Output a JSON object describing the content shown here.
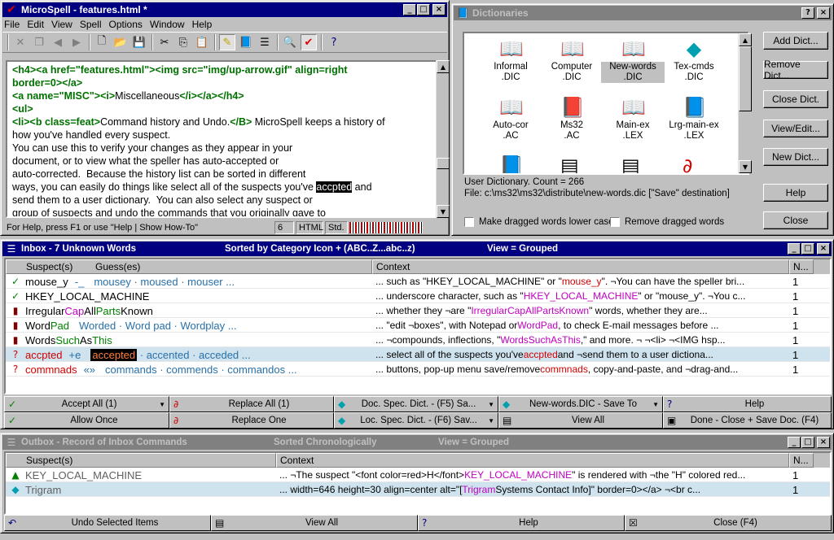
{
  "microspell": {
    "title": "MicroSpell - features.html *",
    "menu": [
      "File",
      "Edit",
      "View",
      "Spell",
      "Options",
      "Window",
      "Help"
    ],
    "editor_lines": [
      {
        "parts": [
          {
            "t": "<h4><a href=\"features.html\"><img src=\"img/up-arrow.gif\" align=right",
            "c": "tag"
          }
        ]
      },
      {
        "parts": [
          {
            "t": "border=0></a>",
            "c": "tag"
          }
        ]
      },
      {
        "parts": [
          {
            "t": "<a name=\"MISC\"><i>",
            "c": "tag"
          },
          {
            "t": "Miscellaneous",
            "c": ""
          },
          {
            "t": "</i></a></h4>",
            "c": "tag"
          }
        ]
      },
      {
        "parts": [
          {
            "t": "<ul>",
            "c": "tag"
          }
        ]
      },
      {
        "parts": [
          {
            "t": "<li><b class=feat>",
            "c": "tag"
          },
          {
            "t": "Command history and Undo.",
            "c": ""
          },
          {
            "t": "</B>",
            "c": "tag"
          },
          {
            "t": " MicroSpell keeps a history of",
            "c": ""
          }
        ]
      },
      {
        "parts": [
          {
            "t": "how you've handled every suspect.",
            "c": ""
          }
        ]
      },
      {
        "parts": [
          {
            "t": "You can use this to verify your changes as they appear in your",
            "c": ""
          }
        ]
      },
      {
        "parts": [
          {
            "t": "document, or to view what the speller has auto-accepted or",
            "c": ""
          }
        ]
      },
      {
        "parts": [
          {
            "t": "auto-corrected.  Because the history list can be sorted in different",
            "c": ""
          }
        ]
      },
      {
        "parts": [
          {
            "t": "ways, you can easily do things like select all of the suspects you've ",
            "c": ""
          },
          {
            "t": "accpted",
            "c": "hl"
          },
          {
            "t": " and",
            "c": ""
          }
        ]
      },
      {
        "parts": [
          {
            "t": "send them to a user dictionary.  You can also select any suspect or",
            "c": ""
          }
        ]
      },
      {
        "parts": [
          {
            "t": "group of suspects and undo the commands that you originally gave to",
            "c": ""
          }
        ]
      }
    ],
    "status": {
      "help": "For Help, press F1 or use \"Help | Show How-To\"",
      "line": "6",
      "mode": "HTML",
      "std": "Std."
    }
  },
  "dictionaries": {
    "title": "Dictionaries",
    "items": [
      {
        "name": "Informal",
        "ext": ".DIC",
        "icon": "book-open-icon"
      },
      {
        "name": "Computer",
        "ext": ".DIC",
        "icon": "book-open-icon"
      },
      {
        "name": "New-words",
        "ext": ".DIC",
        "icon": "book-pen-icon"
      },
      {
        "name": "Tex-cmds",
        "ext": ".DIC",
        "icon": "book-cyan-icon"
      },
      {
        "name": "Auto-cor",
        "ext": ".AC",
        "icon": "book-pen-icon"
      },
      {
        "name": "Ms32",
        "ext": ".AC",
        "icon": "book-red-icon"
      },
      {
        "name": "Main-ex",
        "ext": ".LEX",
        "icon": "book-open-icon"
      },
      {
        "name": "Lrg-main-ex",
        "ext": ".LEX",
        "icon": "book-blue-icon"
      }
    ],
    "selected_index": 2,
    "info_line1": "User Dictionary.   Count = 266",
    "info_line2": "File: c:\\ms32\\ms32\\distribute\\new-words.dic  [\"Save\" destination]",
    "checkbox_lower": "Make dragged words lower case",
    "checkbox_remove": "Remove dragged words",
    "buttons": [
      "Add Dict...",
      "Remove Dict...",
      "Close Dict.",
      "View/Edit...",
      "New Dict...",
      "Help",
      "Close"
    ]
  },
  "inbox": {
    "title": "Inbox  -  7 Unknown Words",
    "sorted": "Sorted by Category Icon + (ABC..Z...abc..z)",
    "view": "View = Grouped",
    "headers": {
      "suspect": "Suspect(s)",
      "guess": "Guess(es)",
      "context": "Context",
      "n": "N..."
    },
    "rows": [
      {
        "icon": "check-red-icon",
        "suspect": "mouse_y",
        "sparts": [
          {
            "t": "mouse_y",
            "c": ""
          }
        ],
        "extra": "-_",
        "guesses": "mousey · moused · mouser ...",
        "context": [
          {
            "t": "... such as \"HKEY_LOCAL_MACHINE\" or \"",
            "c": ""
          },
          {
            "t": "mouse_y",
            "c": "ctxred"
          },
          {
            "t": "\". ¬You can have the speller bri...",
            "c": ""
          }
        ],
        "n": "1"
      },
      {
        "icon": "check-red-icon",
        "suspect": "HKEY_LOCAL_MACHINE",
        "sparts": [
          {
            "t": "HKEY_LOCAL_MACHINE",
            "c": ""
          }
        ],
        "extra": "",
        "guesses": "",
        "context": [
          {
            "t": "... underscore character, such as \"",
            "c": ""
          },
          {
            "t": "HKEY_LOCAL_MACHINE",
            "c": "ctxmag"
          },
          {
            "t": "\" or \"mouse_y\". ¬You c...",
            "c": ""
          }
        ],
        "n": "1"
      },
      {
        "icon": "bars-icon",
        "suspect": "IrregularCapAllPartsKnown",
        "sparts": [
          {
            "t": "Irregular",
            "c": ""
          },
          {
            "t": "Cap",
            "c": "magenta"
          },
          {
            "t": "All",
            "c": ""
          },
          {
            "t": "Parts",
            "c": "green"
          },
          {
            "t": "Known",
            "c": ""
          }
        ],
        "extra": "",
        "guesses": "",
        "context": [
          {
            "t": "... whether they ¬are \"",
            "c": ""
          },
          {
            "t": "IrregularCapAllPartsKnown",
            "c": "ctxmag"
          },
          {
            "t": "\" words, whether they are...",
            "c": ""
          }
        ],
        "n": "1"
      },
      {
        "icon": "bars-icon",
        "suspect": "WordPad",
        "sparts": [
          {
            "t": "Word",
            "c": ""
          },
          {
            "t": "Pad",
            "c": "green"
          }
        ],
        "extra": "",
        "guesses": "Worded · Word pad · Wordplay ...",
        "context": [
          {
            "t": "... \"edit ¬boxes\", with Notepad or ",
            "c": ""
          },
          {
            "t": "WordPad",
            "c": "ctxmag"
          },
          {
            "t": ", to check E-mail messages before ...",
            "c": ""
          }
        ],
        "n": "1"
      },
      {
        "icon": "bars-icon",
        "suspect": "WordsSuchAsThis",
        "sparts": [
          {
            "t": "Words",
            "c": ""
          },
          {
            "t": "Such",
            "c": "green"
          },
          {
            "t": "As",
            "c": ""
          },
          {
            "t": "This",
            "c": "green"
          }
        ],
        "extra": "",
        "guesses": "",
        "context": [
          {
            "t": "... ¬compounds, inflections, \"",
            "c": ""
          },
          {
            "t": "WordsSuchAsThis",
            "c": "ctxmag"
          },
          {
            "t": ",\" and more. ¬ ¬<li> ¬<IMG hsp...",
            "c": ""
          }
        ],
        "n": "1"
      },
      {
        "icon": "question-icon",
        "suspect": "accpted",
        "sparts": [
          {
            "t": "accpted",
            "c": "red"
          }
        ],
        "extra": "+e",
        "guesses_hl": "accepted",
        "guesses": " · accented · acceded ...",
        "context": [
          {
            "t": "... select all of the suspects you've ",
            "c": ""
          },
          {
            "t": "accpted",
            "c": "ctxred"
          },
          {
            "t": " and ¬send them to a user dictiona...",
            "c": ""
          }
        ],
        "n": "1",
        "selected": true
      },
      {
        "icon": "question-icon",
        "suspect": "commnads",
        "sparts": [
          {
            "t": "commnads",
            "c": "red"
          }
        ],
        "extra": "«»",
        "guesses": "commands · commends · commandos ...",
        "context": [
          {
            "t": "... buttons, pop-up menu save/remove ",
            "c": ""
          },
          {
            "t": "commnads",
            "c": "ctxred"
          },
          {
            "t": ", copy-and-paste, and ¬drag-and...",
            "c": ""
          }
        ],
        "n": "1"
      }
    ],
    "actions_row1": [
      {
        "icon": "check-icon",
        "label": "Accept All (1)",
        "dd": true
      },
      {
        "icon": "replace-icon",
        "label": "Replace All (1)",
        "dd": false
      },
      {
        "icon": "book-cyan-icon",
        "label": "Doc. Spec. Dict. - (F5) Sa...",
        "dd": true
      },
      {
        "icon": "book-cyan-icon",
        "label": "New-words.DIC - Save To",
        "dd": true
      },
      {
        "icon": "help-icon",
        "label": "Help",
        "dd": false
      }
    ],
    "actions_row2": [
      {
        "icon": "check-one-icon",
        "label": "Allow Once",
        "dd": false
      },
      {
        "icon": "replace-one-icon",
        "label": "Replace One",
        "dd": false
      },
      {
        "icon": "book-cyan-icon",
        "label": "Loc. Spec. Dict. - (F6) Sav...",
        "dd": true
      },
      {
        "icon": "list-icon",
        "label": "View All",
        "dd": false
      },
      {
        "icon": "save-icon",
        "label": "Done - Close + Save Doc. (F4)",
        "dd": false
      }
    ]
  },
  "outbox": {
    "title": "Outbox  -  Record of Inbox Commands",
    "sorted": "Sorted Chronologically",
    "view": "View = Grouped",
    "headers": {
      "suspect": "Suspect(s)",
      "context": "Context",
      "n": "N..."
    },
    "rows": [
      {
        "icon": "accept-green-icon",
        "suspect": "KEY_LOCAL_MACHINE",
        "context": [
          {
            "t": "... ¬The suspect \"<font color=red>H</font>",
            "c": ""
          },
          {
            "t": "KEY_LOCAL_MACHINE",
            "c": "ctxmag"
          },
          {
            "t": "\" is rendered with ¬the \"H\" colored red...",
            "c": ""
          }
        ],
        "n": "1"
      },
      {
        "icon": "book-cyan-icon",
        "suspect": "Trigram",
        "context": [
          {
            "t": "... width=646 height=30 align=center alt=\"[",
            "c": ""
          },
          {
            "t": "Trigram",
            "c": "ctxmag"
          },
          {
            "t": " Systems Contact Info]\" border=0></a> ¬<br c...",
            "c": ""
          }
        ],
        "n": "1",
        "selected": true
      }
    ],
    "actions": [
      {
        "icon": "undo-icon",
        "label": "Undo Selected Items"
      },
      {
        "icon": "list-icon",
        "label": "View All"
      },
      {
        "icon": "help-icon",
        "label": "Help"
      },
      {
        "icon": "close-x-icon",
        "label": "Close (F4)"
      }
    ]
  }
}
